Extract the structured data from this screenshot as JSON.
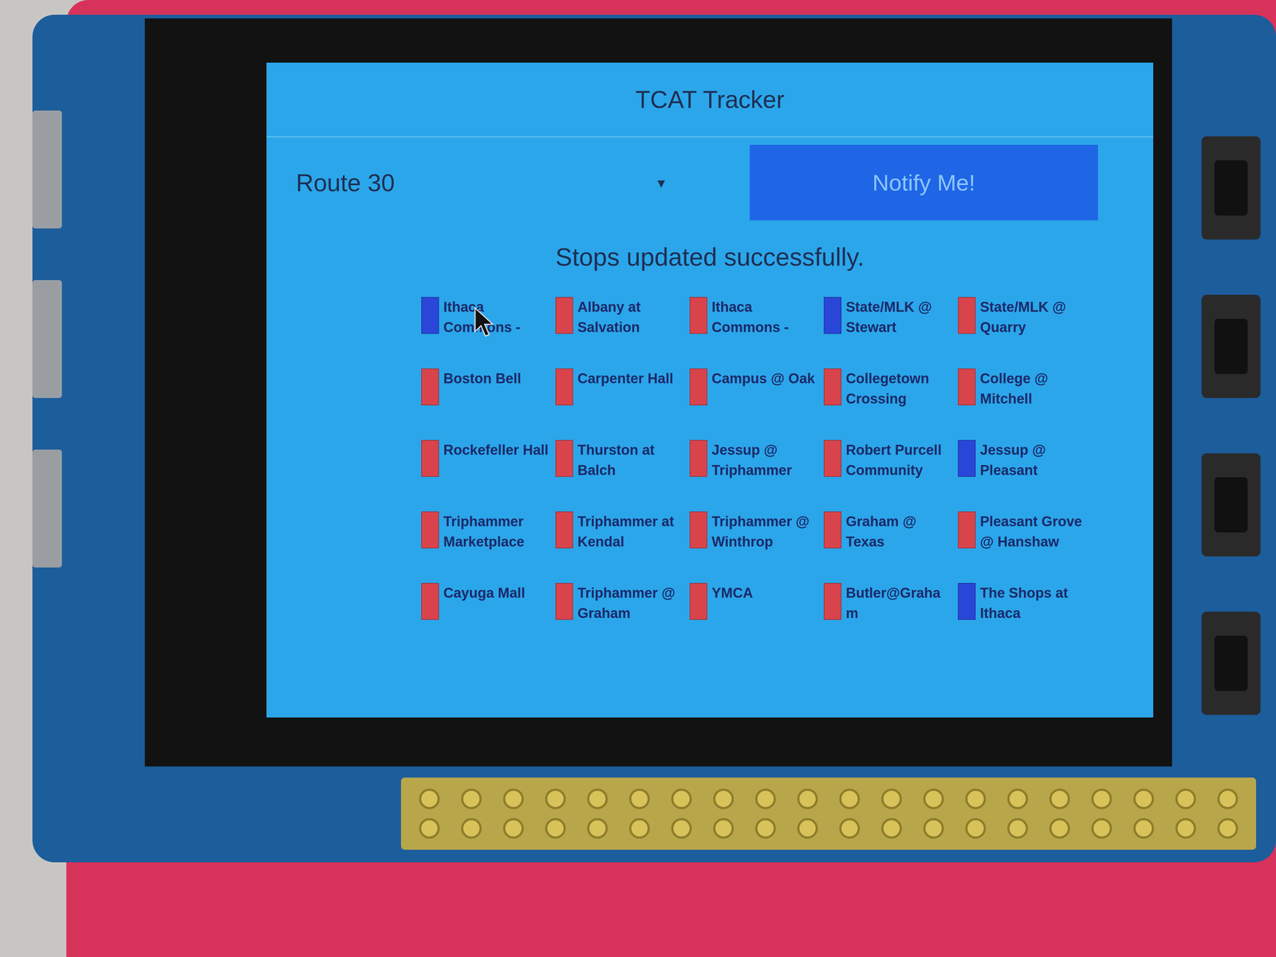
{
  "window": {
    "title": "TCAT Tracker"
  },
  "route_select": {
    "value": "Route 30",
    "arrow": "▾"
  },
  "notify_button": {
    "label": "Notify Me!"
  },
  "status": "Stops updated successfully.",
  "stops": [
    {
      "name": "Ithaca Commons -",
      "color": "#2a46d8"
    },
    {
      "name": "Albany at Salvation",
      "color": "#d9444c"
    },
    {
      "name": "Ithaca Commons -",
      "color": "#d9444c"
    },
    {
      "name": "State/MLK @ Stewart",
      "color": "#2a46d8"
    },
    {
      "name": "State/MLK @ Quarry",
      "color": "#d9444c"
    },
    {
      "name": "Boston Bell",
      "color": "#d9444c"
    },
    {
      "name": "Carpenter Hall",
      "color": "#d9444c"
    },
    {
      "name": "Campus @ Oak",
      "color": "#d9444c"
    },
    {
      "name": "Collegetown Crossing",
      "color": "#d9444c"
    },
    {
      "name": "College @ Mitchell",
      "color": "#d9444c"
    },
    {
      "name": "Rockefeller Hall",
      "color": "#d9444c"
    },
    {
      "name": "Thurston at Balch",
      "color": "#d9444c"
    },
    {
      "name": "Jessup @ Triphammer",
      "color": "#d9444c"
    },
    {
      "name": "Robert Purcell Community",
      "color": "#d9444c"
    },
    {
      "name": "Jessup @ Pleasant",
      "color": "#2a46d8"
    },
    {
      "name": "Triphammer Marketplace",
      "color": "#d9444c"
    },
    {
      "name": "Triphammer at Kendal",
      "color": "#d9444c"
    },
    {
      "name": "Triphammer @ Winthrop",
      "color": "#d9444c"
    },
    {
      "name": "Graham @ Texas",
      "color": "#d9444c"
    },
    {
      "name": "Pleasant Grove @ Hanshaw",
      "color": "#d9444c"
    },
    {
      "name": "Cayuga Mall",
      "color": "#d9444c"
    },
    {
      "name": "Triphammer @ Graham",
      "color": "#d9444c"
    },
    {
      "name": "YMCA",
      "color": "#d9444c"
    },
    {
      "name": "Butler@Graham",
      "color": "#d9444c"
    },
    {
      "name": "The Shops at Ithaca",
      "color": "#2a46d8"
    }
  ]
}
